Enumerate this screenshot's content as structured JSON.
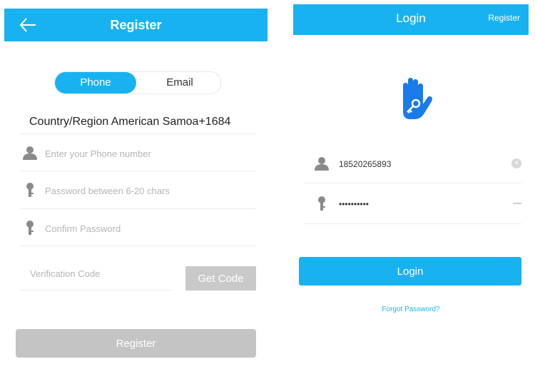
{
  "register_screen": {
    "title": "Register",
    "tabs": {
      "phone": "Phone",
      "email": "Email"
    },
    "country_label": "Country/Region",
    "country_value": "American Samoa+1684",
    "phone_placeholder": "Enter your Phone number",
    "password_placeholder": "Password between 6-20 chars",
    "confirm_placeholder": "Confirm Password",
    "code_placeholder": "Verification Code",
    "get_code_label": "Get Code",
    "register_button": "Register"
  },
  "login_screen": {
    "title": "Login",
    "register_link": "Register",
    "username_value": "18520265893",
    "password_value": "••••••••••",
    "login_button": "Login",
    "forgot_password": "Forgot Password?"
  },
  "colors": {
    "accent": "#19b2f0",
    "disabled": "#c4c4c4"
  },
  "icons": [
    "back-arrow-icon",
    "user-icon",
    "key-icon",
    "hand-key-logo",
    "clear-icon"
  ]
}
